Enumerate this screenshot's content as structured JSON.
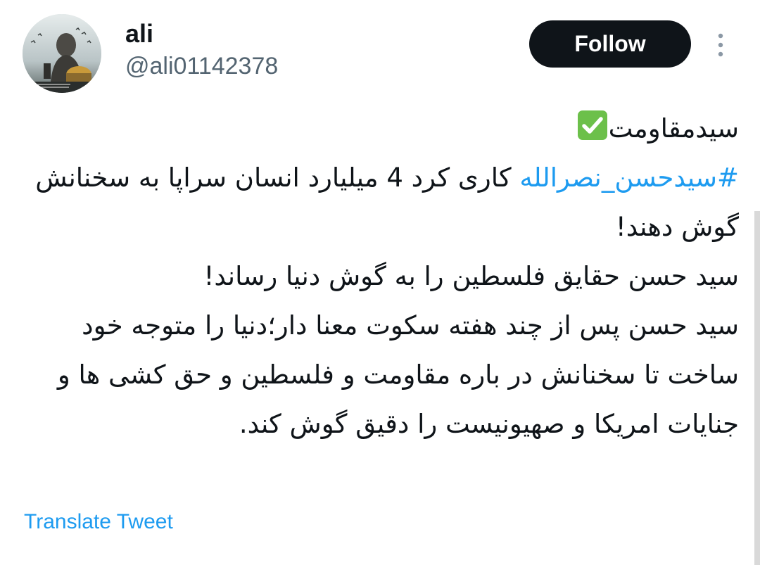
{
  "author": {
    "display_name": "ali",
    "handle": "@ali01142378",
    "avatar_icon": "profile-photo-icon"
  },
  "actions": {
    "follow_label": "Follow",
    "more_icon": "more-vertical-icon"
  },
  "tweet": {
    "line1_text": "سیدمقاومت",
    "line1_emoji_icon": "check-mark-button-icon",
    "para1_hashtag": "#سیدحسن_نصرالله",
    "para1_text": "کاری کرد 4 میلیارد انسان سراپا به سخنانش گوش دهند!",
    "para2_text": "سید حسن حقایق فلسطین را به گوش دنیا رساند!",
    "para3_text": "سید حسن پس از چند هفته سکوت معنا دار؛دنیا را متوجه خود ساخت تا سخنانش در باره مقاومت و فلسطین و حق کشی ها و جنایات امریکا و صهیونیست را دقیق گوش کند."
  },
  "translate_label": "Translate Tweet",
  "colors": {
    "link": "#1d9bf0",
    "text": "#0f1419",
    "secondary_text": "#536471",
    "button_bg": "#0f1419"
  }
}
